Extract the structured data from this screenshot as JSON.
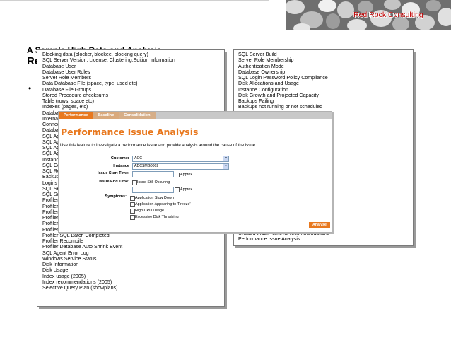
{
  "brand": {
    "name": "Red Rock Consulting"
  },
  "slide": {
    "title_line1": "A Sample High Data and Analysis",
    "title_line2": "Re",
    "bullet": "•"
  },
  "left_panel": {
    "items": [
      "Blocking data (blocker, blockee, blocking query)",
      "SQL Server Version, License, Clustering,Edition Information",
      "Database User",
      "Database User Roles",
      "Server Role Members",
      "Data Database File (space, type, used etc)",
      "Database File Groups",
      "Stored Procedure checksums",
      "Table (rows, space etc)",
      "Indexes (pages, etc)",
      "Databa",
      "Internal",
      "Connec",
      "Databa",
      "SQL Ag",
      "SQL Ag",
      "SQL Ag",
      "SQL Ag",
      "Instance",
      "SQL Co",
      "SQL Re",
      "Backup",
      "Logins",
      "SQL Se",
      "SQL Se",
      "Profiler",
      "Profiler",
      "Profiler",
      "Profiler",
      "Profiler",
      "Profiler RPC:Completed",
      "Profiler SQL Batch Completed",
      "Profiler Recompile",
      "Profiler Database Auto Shrink Event",
      "SQL Agent Error Log",
      "Windows Service Status",
      "Disk Information",
      "Disk Usage",
      "Index usage (2005)",
      "Index recommendations (2005)",
      "Selective Query Plan (showplans)"
    ]
  },
  "right_panel": {
    "items": [
      "SQL Server Build",
      "Server Role Membership",
      "Authentication Mode",
      "Database Ownership",
      "SQL Login Password Policy Compliance",
      "Disk Allocations and Usage",
      "Instance Configuration",
      "Disk Growth and Projected Capacity",
      "Backups Failing",
      "Backups not running or not scheduled"
    ],
    "bottom_items": [
      "Unused Index removal recommendations",
      "Performance Issue Analysis"
    ]
  },
  "app": {
    "tabs": [
      "Performance",
      "Baseline",
      "Consolidation"
    ],
    "title": "Performance Issue Analysis",
    "description": "Use this feature to investigate a performance issue and provide analysis around the cause of the issue.",
    "customer_label": "Customer",
    "customer_value": "ACC",
    "instance_label": "Instance",
    "instance_value": "ADCSMG0002",
    "start_label": "Issue Start Time:",
    "end_label": "Issue End Time:",
    "approx_label": "Approx",
    "still_occuring_label": "Issue Still Occuring",
    "symptoms_label": "Symptoms:",
    "symptoms": [
      "Application Slow Down",
      "Application Appearing to 'Freeze'",
      "High CPU Usage",
      "Excessive Disk Thrashing"
    ],
    "analyse_label": "Analyse",
    "accent_color": "#e8781e"
  }
}
